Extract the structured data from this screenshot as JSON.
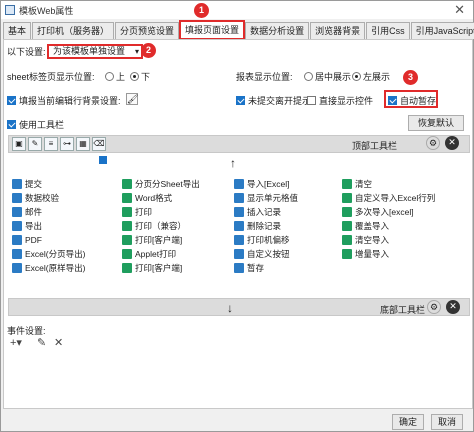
{
  "window": {
    "title": "模板Web属性",
    "close_label": "✕"
  },
  "tabs": [
    {
      "label": "基本",
      "active": false
    },
    {
      "label": "打印机（服务器）",
      "active": false
    },
    {
      "label": "分页预览设置",
      "active": false
    },
    {
      "label": "填报页面设置",
      "active": true
    },
    {
      "label": "数据分析设置",
      "active": false
    },
    {
      "label": "浏览器背景",
      "active": false
    },
    {
      "label": "引用Css",
      "active": false
    },
    {
      "label": "引用JavaScript",
      "active": false
    }
  ],
  "settings": {
    "scope_label": "以下设置:",
    "scope_value": "为该模板单独设置",
    "sheet_pos_label": "sheet标签页显示位置:",
    "sheet_pos_top": "上",
    "sheet_pos_bottom": "下",
    "report_pos_label": "报表显示位置:",
    "report_pos_center": "居中展示",
    "report_pos_left": "左展示",
    "bg_label": "填报当前编辑行背景设置:",
    "unsubmitted_label": "未提交离开提示",
    "direct_ctrl_label": "直接显示控件",
    "autosave_label": "自动暂存",
    "toolbar_label": "使用工具栏",
    "restore_default": "恢复默认"
  },
  "badges": {
    "b1": "1",
    "b2": "2",
    "b3": "3"
  },
  "top_toolbar": {
    "label": "顶部工具栏",
    "arrow": "↑"
  },
  "bottom_toolbar": {
    "label": "底部工具栏",
    "arrow": "↓"
  },
  "buttons_grid": [
    [
      "提交",
      "分页分Sheet导出",
      "导入[Excel]",
      "清空"
    ],
    [
      "数据校验",
      "Word格式",
      "显示单元格值",
      "自定义导入Excel行列"
    ],
    [
      "邮件",
      "打印",
      "插入记录",
      "多次导入[excel]"
    ],
    [
      "导出",
      "打印（兼容）",
      "删除记录",
      "覆盖导入"
    ],
    [
      "PDF",
      "打印[客户端]",
      "打印机偏移",
      "清空导入"
    ],
    [
      "Excel(分页导出)",
      "Applet打印",
      "自定义按钮",
      "增量导入"
    ],
    [
      "Excel(原样导出)",
      "打印[客户端]",
      "暂存",
      ""
    ]
  ],
  "events": {
    "label": "事件设置:"
  },
  "footer": {
    "ok": "确定",
    "cancel": "取消"
  },
  "colors": {
    "accent_red": "#e02b2b",
    "check_blue": "#1a73c8"
  }
}
